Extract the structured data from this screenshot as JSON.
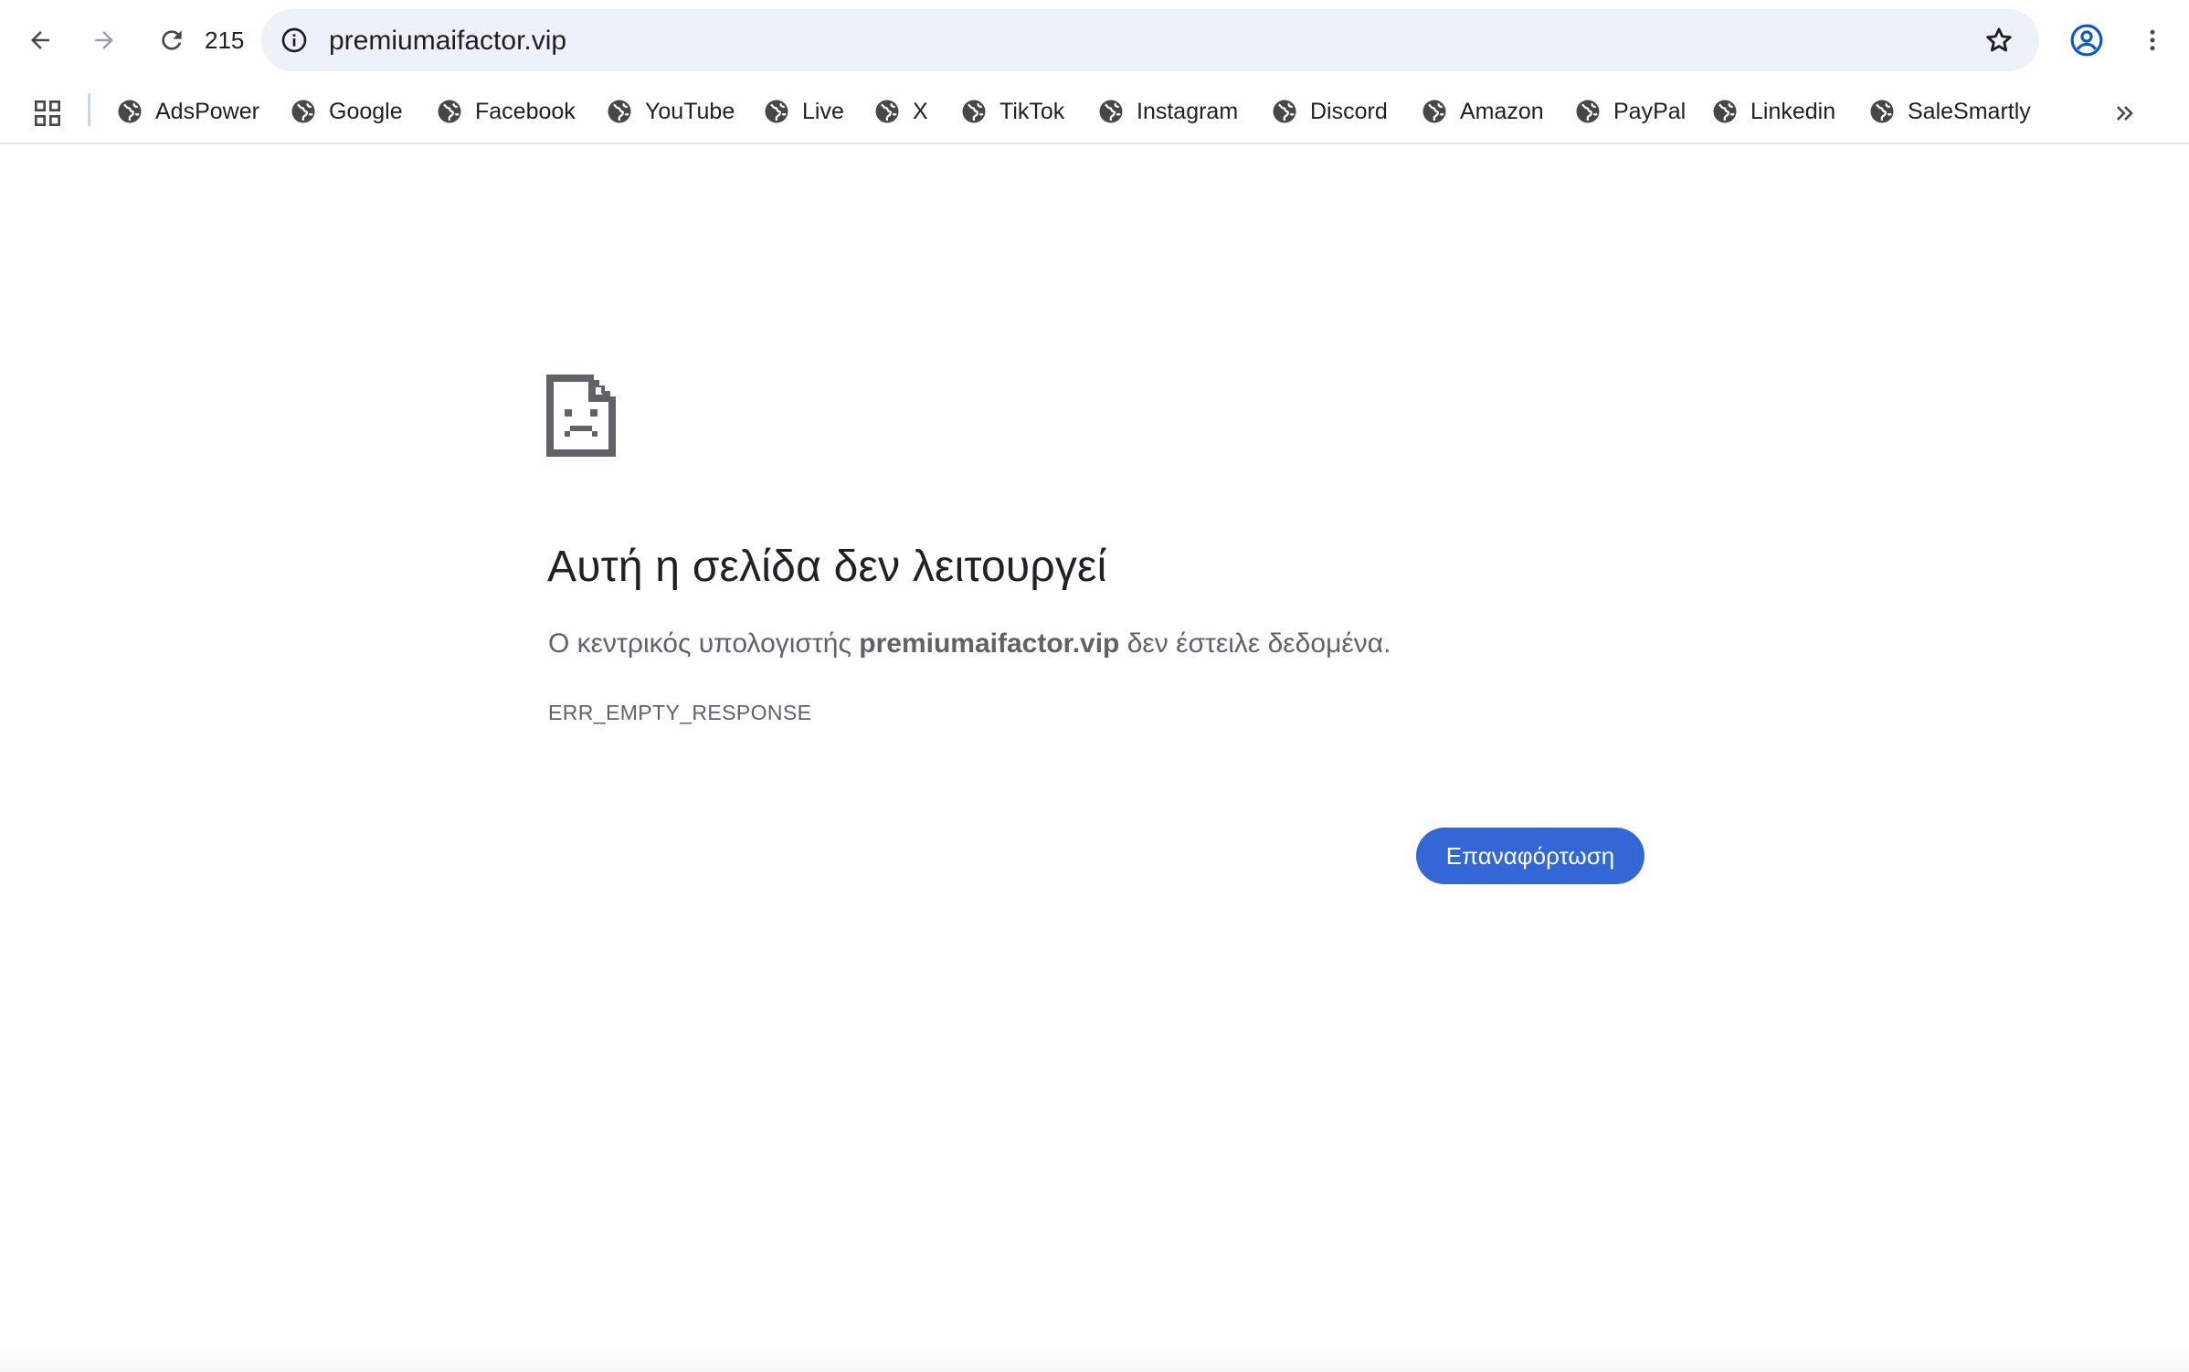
{
  "browser": {
    "nav": {
      "back_icon": "arrow-left-icon",
      "forward_icon": "arrow-right-icon",
      "reload_icon": "reload-icon",
      "reload_count": "215"
    },
    "omnibox": {
      "url": "premiumaifactor.vip",
      "info_icon": "info-icon",
      "star_icon": "star-icon"
    },
    "profile_icon": "profile-icon",
    "menu_icon": "kebab-menu-icon"
  },
  "bookmarks": {
    "apps_icon": "apps-grid-icon",
    "items": [
      {
        "label": "AdsPower"
      },
      {
        "label": "Google"
      },
      {
        "label": "Facebook"
      },
      {
        "label": "YouTube"
      },
      {
        "label": "Live"
      },
      {
        "label": "X"
      },
      {
        "label": "TikTok"
      },
      {
        "label": "Instagram"
      },
      {
        "label": "Discord"
      },
      {
        "label": "Amazon"
      },
      {
        "label": "PayPal"
      },
      {
        "label": "Linkedin"
      },
      {
        "label": "SaleSmartly"
      }
    ],
    "overflow_icon": "double-chevron-right-icon"
  },
  "error_page": {
    "icon": "sad-document-icon",
    "title": "Αυτή η σελίδα δεν λειτουργεί",
    "desc_prefix": "Ο κεντρικός υπολογιστής ",
    "desc_host": "premiumaifactor.vip",
    "desc_suffix": " δεν έστειλε δεδομένα.",
    "code": "ERR_EMPTY_RESPONSE",
    "reload_label": "Επαναφόρτωση"
  },
  "colors": {
    "omnibox_bg": "#edf2fa",
    "button_bg": "#3367d6",
    "icon": "#474747",
    "text_primary": "#202124",
    "text_secondary": "#5f6368"
  }
}
